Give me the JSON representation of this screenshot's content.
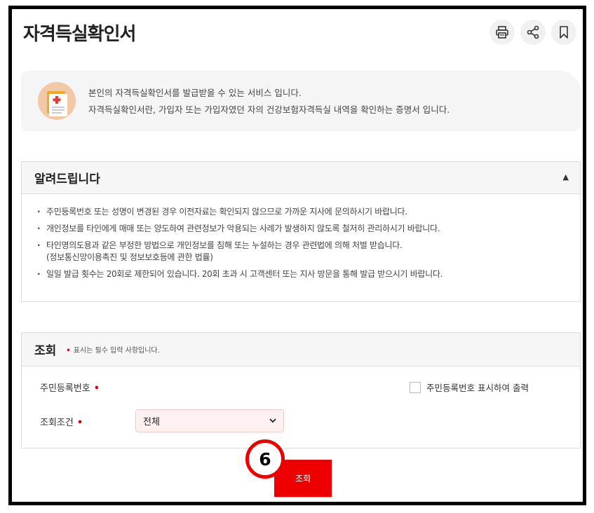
{
  "page": {
    "title": "자격득실확인서"
  },
  "toolbar": {
    "icons": [
      "print-icon",
      "share-icon",
      "bookmark-icon"
    ]
  },
  "info": {
    "line1": "본인의 자격득실확인서를 발급받을 수 있는 서비스 입니다.",
    "line2": "자격득실확인서란, 가입자 또는 가입자였던 자의 건강보험자격득실 내역을 확인하는 증명서 입니다.",
    "icon": "document-icon"
  },
  "notice": {
    "title": "알려드립니다",
    "toggle": "▲",
    "items": [
      "주민등록번호 또는 성명이 변경된 경우 이전자료는 확인되지 않으므로 가까운 지사에 문의하시기 바랍니다.",
      "개인정보를 타인에게 매매 또는 양도하여 관련정보가 악용되는 사례가 발생하지 않도록 철저히 관리하시기 바랍니다.",
      "타인명의도용과 같은 부정한 방법으로 개인정보를 침해 또는 누설하는 경우 관련법에 의해 처벌 받습니다.",
      "(정보통신망이용촉진 및 정보보호등에 관한 법률)",
      "일일 발급 횟수는 20회로 제한되어 있습니다. 20회 초과 시 고객센터 또는 지사 방문을 통해 발급 받으시기 바랍니다."
    ]
  },
  "query": {
    "title": "조회",
    "required_note": "표시는 필수 입력 사항입니다.",
    "resident_label": "주민등록번호",
    "checkbox_label": "주민등록번호 표시하여 출력",
    "condition_label": "조회조건",
    "condition_value": "전체"
  },
  "action": {
    "search_label": "조회",
    "step_number": "6"
  },
  "colors": {
    "accent_red": "#ee0000",
    "required_red": "#d0021b",
    "select_bg": "#fff1f1"
  }
}
